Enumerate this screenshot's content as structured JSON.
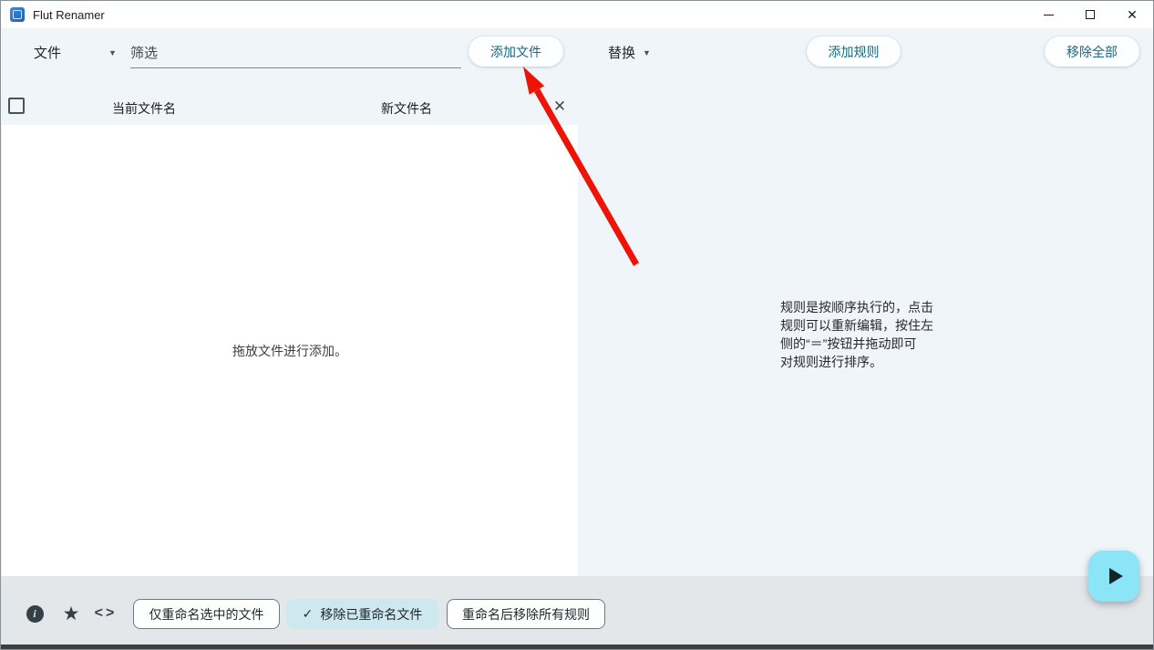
{
  "window": {
    "title": "Flut Renamer"
  },
  "toolbar": {
    "file_menu_label": "文件",
    "filter_placeholder": "筛选",
    "add_files_label": "添加文件",
    "replace_menu_label": "替换",
    "add_rule_label": "添加规则",
    "remove_all_label": "移除全部"
  },
  "file_table": {
    "col_current": "当前文件名",
    "col_new": "新文件名",
    "empty_hint": "拖放文件进行添加。",
    "select_all_checked": false
  },
  "rules_panel": {
    "hint": "规则是按顺序执行的，点击\n规则可以重新编辑，按住左\n侧的“＝”按钮并拖动即可\n对规则进行排序。"
  },
  "bottom_bar": {
    "chip_rename_selected_label": "仅重命名选中的文件",
    "chip_remove_renamed_label": "移除已重命名文件",
    "chip_remove_renamed_checked": true,
    "chip_remove_rules_label": "重命名后移除所有规则"
  },
  "icons": {
    "caret_down": "▼",
    "list_close": "✕",
    "window_close": "✕",
    "info": "i",
    "star": "★",
    "code": "<>",
    "check": "✓"
  },
  "colors": {
    "accent_teal": "#17697d",
    "main_bg": "#f0f5f9",
    "bottombar_bg": "#e3e7ea",
    "chip_selected_bg": "#cde8ee",
    "fab_bg": "#8ce5f7",
    "arrow_red": "#ee1306"
  }
}
